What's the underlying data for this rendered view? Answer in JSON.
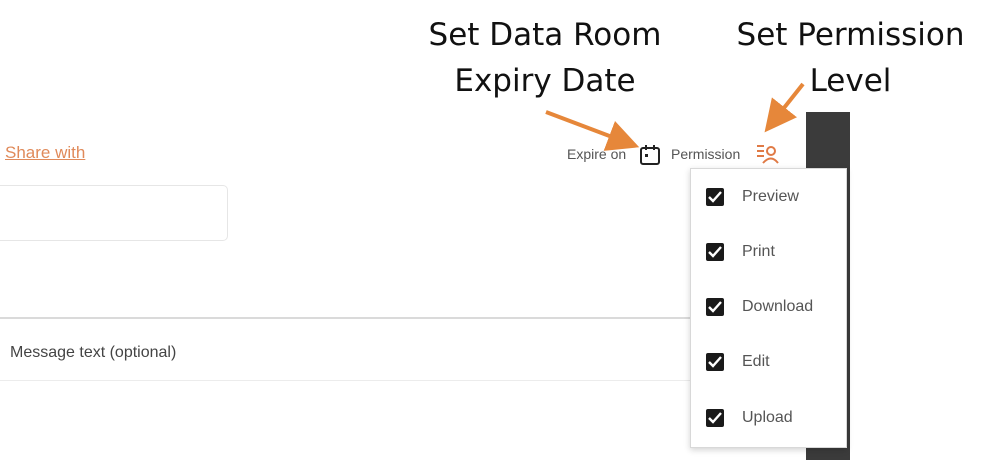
{
  "annotations": {
    "expiry_line1": "Set Data Room",
    "expiry_line2": "Expiry Date",
    "permission_line1": "Set Permission",
    "permission_line2": "Level"
  },
  "share": {
    "link_label": "Share with",
    "input_value": ""
  },
  "toolbar": {
    "expire_label": "Expire on",
    "permission_label": "Permission",
    "calendar_icon": "calendar-icon",
    "permission_icon": "permission-level-icon"
  },
  "message": {
    "placeholder": "Message text (optional)"
  },
  "permissions": {
    "options": [
      {
        "label": "Preview",
        "checked": true
      },
      {
        "label": "Print",
        "checked": true
      },
      {
        "label": "Download",
        "checked": true
      },
      {
        "label": "Edit",
        "checked": true
      },
      {
        "label": "Upload",
        "checked": true
      }
    ]
  },
  "colors": {
    "accent": "#e08a5a",
    "arrow": "#e6873a",
    "dark_panel": "#3b3b3b"
  }
}
